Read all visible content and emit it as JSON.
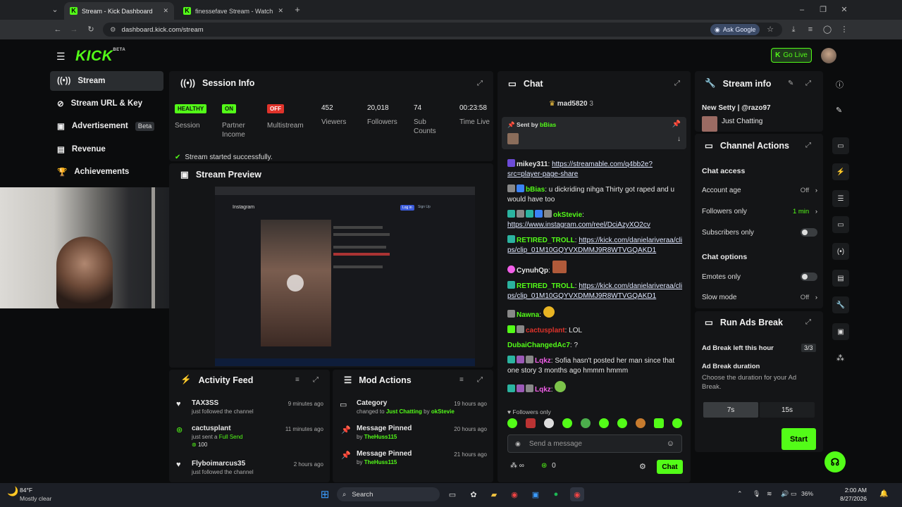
{
  "browser": {
    "tabs": [
      {
        "title": "Stream - Kick Dashboard"
      },
      {
        "title": "finessefave Stream - Watch Live"
      }
    ],
    "new_tab": "+",
    "url": "dashboard.kick.com/stream",
    "ask_google": "Ask Google"
  },
  "header": {
    "logo": "KICK",
    "logo_badge": "BETA",
    "go_live": "Go Live"
  },
  "sidebar": {
    "items": [
      {
        "label": "Stream"
      },
      {
        "label": "Stream URL & Key"
      },
      {
        "label": "Advertisement",
        "badge": "Beta"
      },
      {
        "label": "Revenue"
      },
      {
        "label": "Achievements"
      }
    ]
  },
  "session": {
    "title": "Session Info",
    "chips": [
      {
        "chip": "HEALTHY",
        "label": "Session",
        "color": "#53fc18"
      },
      {
        "chip": "ON",
        "label": "Partner Income",
        "color": "#53fc18"
      },
      {
        "chip": "OFF",
        "label": "Multistream",
        "color": "#e0332b"
      }
    ],
    "stats": [
      {
        "value": "452",
        "label": "Viewers"
      },
      {
        "value": "20,018",
        "label": "Followers"
      },
      {
        "value": "74",
        "label": "Sub Counts"
      },
      {
        "value": "00:23:58",
        "label": "Time Live"
      }
    ],
    "status": "Stream started successfully."
  },
  "preview": {
    "title": "Stream Preview",
    "insta_header": "Instagram",
    "login": "Log in",
    "signup": "Sign Up"
  },
  "activity": {
    "title": "Activity Feed",
    "items": [
      {
        "user": "TAX3SS",
        "text": "just followed the channel",
        "time": "9 minutes ago"
      },
      {
        "user": "cactusplant",
        "text": "just sent a",
        "highlight": "Full Send",
        "amount": "100",
        "time": "11 minutes ago"
      },
      {
        "user": "Flyboimarcus35",
        "text": "just followed the channel",
        "time": "2 hours ago"
      }
    ]
  },
  "modactions": {
    "title": "Mod Actions",
    "items": [
      {
        "title": "Category",
        "pre": "changed to",
        "target": "Just Chatting",
        "by": "by",
        "user": "okStevie",
        "time": "19 hours ago"
      },
      {
        "title": "Message Pinned",
        "by": "by",
        "user": "TheHuss115",
        "time": "20 hours ago"
      },
      {
        "title": "Message Pinned",
        "by": "by",
        "user": "TheHuss115",
        "time": "21 hours ago"
      }
    ]
  },
  "chat": {
    "title": "Chat",
    "top_user": "mad5820",
    "top_count": "3",
    "pinned": {
      "label": "Sent by",
      "user": "bBias"
    },
    "messages": [
      {
        "user": "mikey311",
        "color": "#e0e0e0",
        "text": "https://streamable.com/q4bb2e?src=player-page-share",
        "link": true
      },
      {
        "user": "bBias",
        "color": "#53fc18",
        "text": "u dickriding nihga Thirty got raped and u would have too"
      },
      {
        "user": "okStevie",
        "color": "#53fc18",
        "text": "https://www.instagram.com/reel/DciAzyXO2cv",
        "link": true
      },
      {
        "user": "RETIRED_TROLL",
        "color": "#53fc18",
        "text": "https://kick.com/danielariveraa/clips/clip_01M10GQYVXDMMJ9R8WTVGQAKD1",
        "link": true
      },
      {
        "user": "CynuhQp",
        "color": "#e0e0e0",
        "text": ""
      },
      {
        "user": "RETIRED_TROLL",
        "color": "#53fc18",
        "text": "https://kick.com/danielariveraa/clips/clip_01M10GQYVXDMMJ9R8WTVGQAKD1",
        "link": true
      },
      {
        "user": "Nawna",
        "color": "#53fc18",
        "text": ""
      },
      {
        "user": "cactusplant",
        "color": "#e0332b",
        "text": "LOL"
      },
      {
        "user": "DubaiChangedAc7",
        "color": "#53fc18",
        "text": "?"
      },
      {
        "user": "Lqkz",
        "color": "#f25fe8",
        "text": "Sofia hasn't posted her man since that one story 3 months ago hmmm hmmm"
      },
      {
        "user": "Lqkz",
        "color": "#f25fe8",
        "text": ""
      }
    ],
    "followers_only": "Followers only",
    "placeholder": "Send a message",
    "points": "0",
    "send": "Chat"
  },
  "streaminfo": {
    "title": "Stream info",
    "stream_title": "New Setty | @razo97",
    "category": "Just Chatting"
  },
  "channelactions": {
    "title": "Channel Actions",
    "chat_access": "Chat access",
    "rows": [
      {
        "label": "Account age",
        "value": "Off"
      },
      {
        "label": "Followers only",
        "value": "1 min"
      },
      {
        "label": "Subscribers only",
        "value": ""
      }
    ],
    "chat_options": "Chat options",
    "rows2": [
      {
        "label": "Emotes only",
        "value": ""
      },
      {
        "label": "Slow mode",
        "value": "Off"
      }
    ]
  },
  "ads": {
    "title": "Run Ads Break",
    "left_label": "Ad Break left this hour",
    "left_value": "3/3",
    "duration_label": "Ad Break duration",
    "duration_desc": "Choose the duration for your Ad Break.",
    "opt1": "7s",
    "opt2": "15s",
    "start": "Start"
  },
  "taskbar": {
    "temp": "84°F",
    "weather": "Mostly clear",
    "search": "Search",
    "battery": "36%",
    "time": "2:00 AM",
    "date": "8/27/2026"
  },
  "colors": {
    "accent": "#53fc18",
    "danger": "#e0332b",
    "panel": "#141517"
  }
}
